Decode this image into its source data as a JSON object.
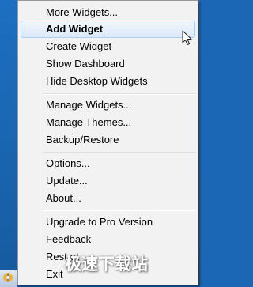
{
  "menu": {
    "items": [
      {
        "label": "More Widgets..."
      },
      {
        "label": "Add Widget"
      },
      {
        "label": "Create Widget"
      },
      {
        "label": "Show Dashboard"
      },
      {
        "label": "Hide Desktop Widgets"
      },
      {
        "label": "Manage Widgets..."
      },
      {
        "label": "Manage Themes..."
      },
      {
        "label": "Backup/Restore"
      },
      {
        "label": "Options..."
      },
      {
        "label": "Update..."
      },
      {
        "label": "About..."
      },
      {
        "label": "Upgrade to Pro Version"
      },
      {
        "label": "Feedback"
      },
      {
        "label": "Restart"
      },
      {
        "label": "Exit"
      }
    ],
    "highlighted_color": "#dce9f8"
  },
  "watermark": {
    "text": "极速下载站"
  },
  "icons": {
    "tray_app": "tray-app-icon",
    "cursor": "mouse-cursor-icon"
  }
}
